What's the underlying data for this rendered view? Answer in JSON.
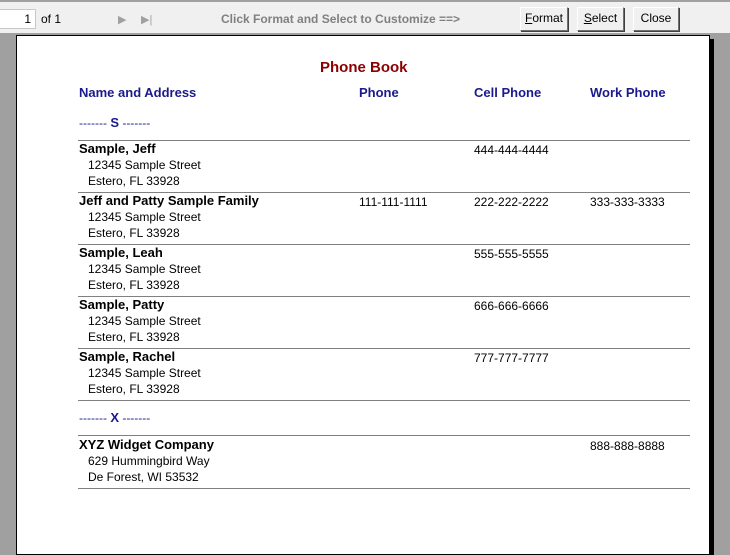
{
  "toolbar": {
    "page_number": "1",
    "page_of": "of 1",
    "next_glyph": "▶",
    "last_glyph": "▶|",
    "hint": "Click Format and Select to Customize ==>",
    "format_button": {
      "accel": "F",
      "rest": "ormat"
    },
    "select_button": {
      "accel": "S",
      "rest": "elect"
    },
    "close_button": "Close"
  },
  "report": {
    "title": "Phone Book",
    "columns": [
      "Name and Address",
      "Phone",
      "Cell Phone",
      "Work Phone"
    ],
    "groups": [
      {
        "label_prefix": "------- ",
        "letter": "S",
        "label_suffix": " -------"
      },
      {
        "label_prefix": "------- ",
        "letter": "X",
        "label_suffix": " -------"
      }
    ],
    "entries": [
      {
        "name": "Sample, Jeff",
        "street": "12345 Sample Street",
        "city": "Estero, FL  33928",
        "phone": "",
        "cell": "444-444-4444",
        "work": ""
      },
      {
        "name": "Jeff and Patty Sample Family",
        "street": "12345 Sample Street",
        "city": "Estero, FL  33928",
        "phone": "111-111-1111",
        "cell": "222-222-2222",
        "work": "333-333-3333"
      },
      {
        "name": "Sample, Leah",
        "street": "12345 Sample Street",
        "city": "Estero, FL  33928",
        "phone": "",
        "cell": "555-555-5555",
        "work": ""
      },
      {
        "name": "Sample, Patty",
        "street": "12345 Sample Street",
        "city": "Estero, FL  33928",
        "phone": "",
        "cell": "666-666-6666",
        "work": ""
      },
      {
        "name": "Sample, Rachel",
        "street": "12345 Sample Street",
        "city": "Estero, FL  33928",
        "phone": "",
        "cell": "777-777-7777",
        "work": ""
      },
      {
        "name": "XYZ Widget Company",
        "street": "629 Hummingbird Way",
        "city": "De Forest, WI  53532",
        "phone": "",
        "cell": "",
        "work": "888-888-8888"
      }
    ]
  }
}
